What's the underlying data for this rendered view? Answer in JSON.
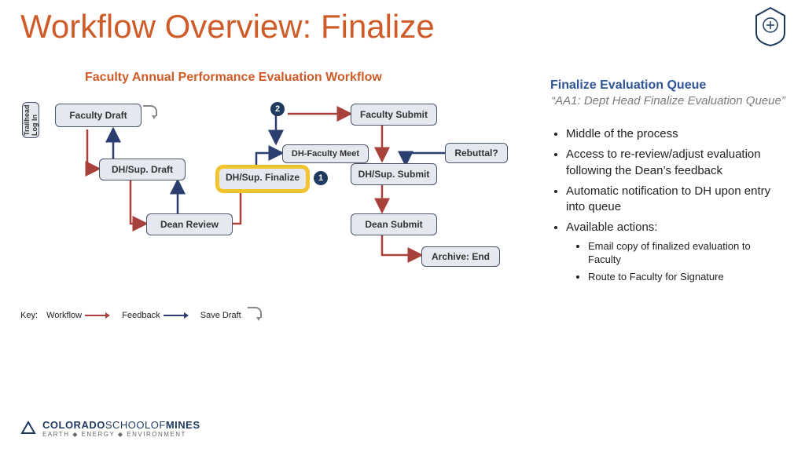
{
  "title": "Workflow Overview: Finalize",
  "diagram": {
    "title": "Faculty Annual Performance Evaluation Workflow",
    "login": "Trailhead\nLog In",
    "nodes": {
      "faculty_draft": "Faculty Draft",
      "dh_draft": "DH/Sup. Draft",
      "dean_review": "Dean Review",
      "dh_faculty_meet": "DH-Faculty Meet",
      "dh_finalize": "DH/Sup. Finalize",
      "faculty_submit": "Faculty Submit",
      "rebuttal": "Rebuttal?",
      "dh_submit": "DH/Sup. Submit",
      "dean_submit": "Dean Submit",
      "archive": "Archive: End"
    },
    "badges": {
      "one": "1",
      "two": "2"
    },
    "key": {
      "label": "Key:",
      "workflow": "Workflow",
      "feedback": "Feedback",
      "save": "Save Draft"
    }
  },
  "panel": {
    "heading": "Finalize Evaluation Queue",
    "sub": "“AA1: Dept Head Finalize Evaluation Queue”",
    "b1": "Middle of the process",
    "b2": "Access to re-review/adjust evaluation following the Dean’s feedback",
    "b3": "Automatic notification to DH upon entry into queue",
    "b4": "Available actions:",
    "s1": "Email copy of finalized evaluation to Faculty",
    "s2": "Route to Faculty for Signature"
  },
  "footer": {
    "brand1": "COLORADO",
    "brand2": "SCHOOLOF",
    "brand3": "MINES",
    "tag": "EARTH ◆ ENERGY ◆ ENVIRONMENT"
  }
}
